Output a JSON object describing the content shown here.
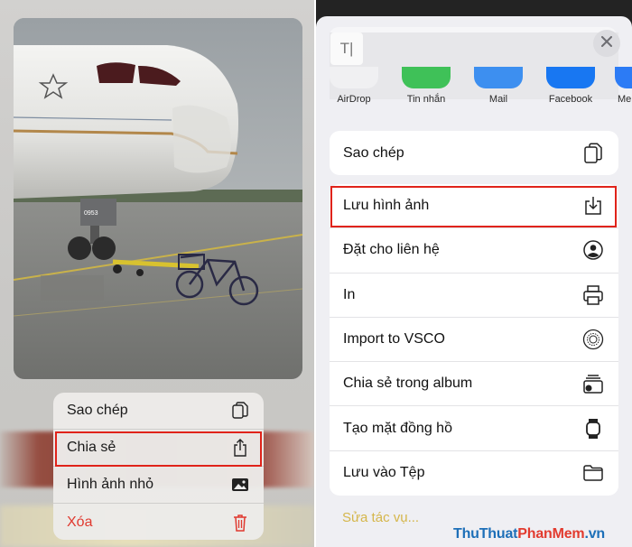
{
  "left_panel": {
    "context_menu": {
      "items": [
        {
          "label": "Sao chép",
          "icon": "copy-icon",
          "highlighted": false,
          "destructive": false
        },
        {
          "label": "Chia sẻ",
          "icon": "share-icon",
          "highlighted": true,
          "destructive": false
        },
        {
          "label": "Hình ảnh nhỏ",
          "icon": "photo-icon",
          "highlighted": false,
          "destructive": false
        },
        {
          "label": "Xóa",
          "icon": "trash-icon",
          "highlighted": false,
          "destructive": true
        }
      ]
    }
  },
  "share_sheet": {
    "header_thumb_text": "T|",
    "apps": [
      {
        "label": "AirDrop",
        "color": "#f0f0f2"
      },
      {
        "label": "Tin nhắn",
        "color": "#3fc158"
      },
      {
        "label": "Mail",
        "color": "#3d8ff0"
      },
      {
        "label": "Facebook",
        "color": "#1877f2"
      },
      {
        "label": "Me",
        "color": "#2c7bf5"
      }
    ],
    "group1": [
      {
        "label": "Sao chép",
        "icon": "copy-icon"
      }
    ],
    "group2": [
      {
        "label": "Lưu hình ảnh",
        "icon": "save-image-icon",
        "highlighted": true
      },
      {
        "label": "Đặt cho liên hệ",
        "icon": "contact-icon"
      },
      {
        "label": "In",
        "icon": "printer-icon"
      },
      {
        "label": "Import to VSCO",
        "icon": "vsco-icon"
      },
      {
        "label": "Chia sẻ trong album",
        "icon": "shared-album-icon"
      },
      {
        "label": "Tạo mặt đồng hồ",
        "icon": "watch-icon"
      },
      {
        "label": "Lưu vào Tệp",
        "icon": "folder-icon"
      }
    ],
    "edit_actions": "Sửa tác vụ..."
  },
  "watermark": {
    "part1": "ThuThuat",
    "part2": "PhanMem",
    "part3": ".vn"
  },
  "colors": {
    "highlight": "#e0231a",
    "destructive": "#e0392f",
    "edit_link": "#d5b64a"
  }
}
